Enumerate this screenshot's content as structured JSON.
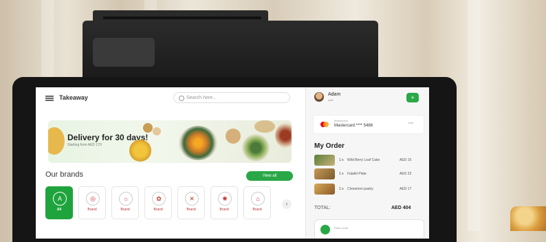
{
  "app": {
    "brand": "Takeaway"
  },
  "search": {
    "placeholder": "Search here..."
  },
  "banner": {
    "title": "Delivery for 30 days!",
    "subtitle": "Starting from AED 179"
  },
  "brands": {
    "title": "Our brands",
    "view_all_label": "View all",
    "items": [
      {
        "name": "All",
        "logo": "A",
        "active": true
      },
      {
        "name": "Brand",
        "logo": "◎",
        "active": false
      },
      {
        "name": "Brand",
        "logo": "☼",
        "active": false
      },
      {
        "name": "Brand",
        "logo": "✿",
        "active": false
      },
      {
        "name": "Brand",
        "logo": "✕",
        "active": false
      },
      {
        "name": "Brand",
        "logo": "✺",
        "active": false
      },
      {
        "name": "Brand",
        "logo": "⌂",
        "active": false
      }
    ],
    "next_icon": "›"
  },
  "user": {
    "name": "Adam",
    "role": "staff",
    "add_icon": "+"
  },
  "payment": {
    "label": "Mastercard",
    "number": "Mastercard **** 5486",
    "edit": "Edit"
  },
  "order": {
    "title": "My Order",
    "items": [
      {
        "qty": "1 x",
        "name": "Wild Berry Loaf Cake",
        "price": "AED 15"
      },
      {
        "qty": "1 x",
        "name": "Falafel Plate",
        "price": "AED 22"
      },
      {
        "qty": "1 x",
        "name": "Cinnamon pastry",
        "price": "AED 17"
      }
    ],
    "total_label": "TOTAL:",
    "total_value": "AED 404",
    "checkout_label": "Place order"
  },
  "colors": {
    "accent": "#2aa847",
    "background": "#fafafa"
  }
}
